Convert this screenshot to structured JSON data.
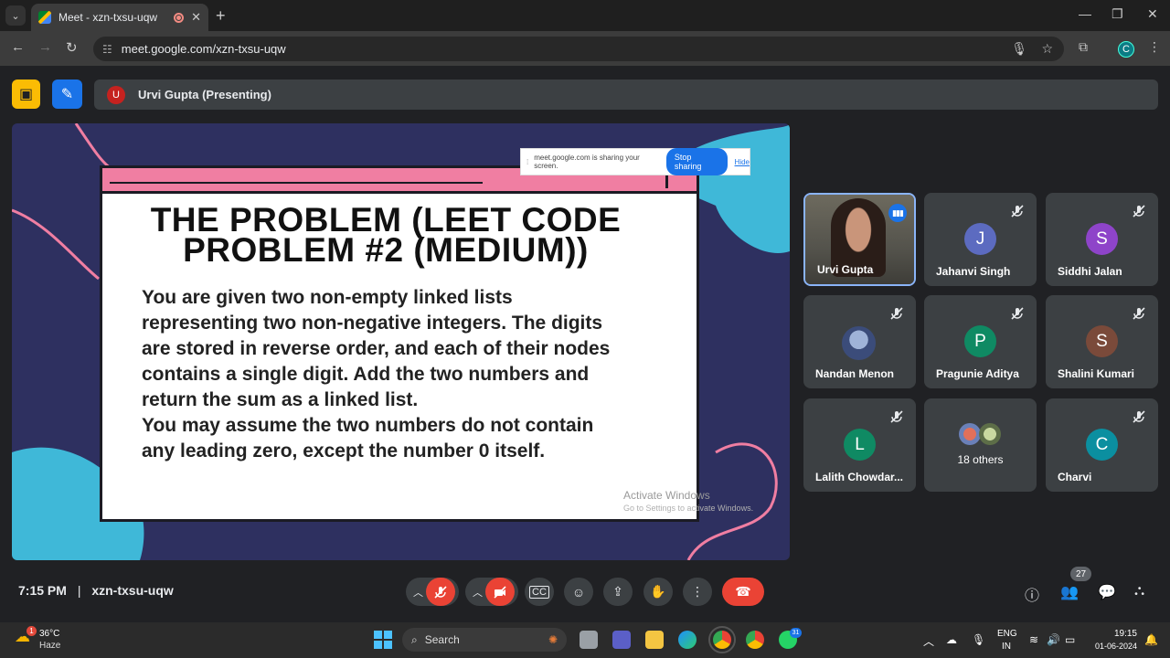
{
  "browser": {
    "tab_title": "Meet - xzn-txsu-uqw",
    "url": "meet.google.com/xzn-txsu-uqw",
    "profile_initial": "C"
  },
  "meet": {
    "presenter_initial": "U",
    "presenter_label": "Urvi Gupta (Presenting)",
    "time": "7:15 PM",
    "separator": "|",
    "meeting_code": "xzn-txsu-uqw",
    "people_count": "27"
  },
  "share_banner": {
    "text": "meet.google.com is sharing your screen.",
    "stop_label": "Stop sharing",
    "hide_label": "Hide"
  },
  "slide": {
    "title_line1": "THE PROBLEM (LEET CODE",
    "title_line2": "PROBLEM #2 (MEDIUM))",
    "body": [
      "You are given two non-empty linked lists",
      "representing two non-negative integers. The digits",
      "are stored in reverse order, and each of their nodes",
      "contains a single digit. Add the two numbers and",
      "return the sum as a linked list.",
      "You may assume the two numbers do not contain",
      "any leading zero, except the number 0 itself."
    ],
    "watermark_line1": "Activate Windows",
    "watermark_line2": "Go to Settings to activate Windows."
  },
  "participants": [
    {
      "name": "Urvi Gupta",
      "initial": "",
      "color": ""
    },
    {
      "name": "Jahanvi Singh",
      "initial": "J",
      "color": "#5c6bc0"
    },
    {
      "name": "Siddhi Jalan",
      "initial": "S",
      "color": "#8e44c9"
    },
    {
      "name": "Nandan Menon",
      "initial": "",
      "color": "#6d7fa8"
    },
    {
      "name": "Pragunie Aditya",
      "initial": "P",
      "color": "#0f8a63"
    },
    {
      "name": "Shalini Kumari",
      "initial": "S",
      "color": "#7a4a3a"
    },
    {
      "name": "Lalith Chowdar...",
      "initial": "L",
      "color": "#0f8a63"
    },
    {
      "name": "18 others",
      "initial": "",
      "color": ""
    },
    {
      "name": "Charvi",
      "initial": "C",
      "color": "#0b8fa0"
    }
  ],
  "taskbar": {
    "temp": "36°C",
    "weather": "Haze",
    "weather_badge": "1",
    "search_label": "Search",
    "lang1": "ENG",
    "lang2": "IN",
    "time": "19:15",
    "date": "01-06-2024",
    "whatsapp_badge": "31"
  },
  "colors": {
    "accent_blue": "#1a73e8",
    "end_call_red": "#ea4335",
    "meet_yellow": "#fbbc04",
    "slide_background": "#2e3060",
    "slide_header_pink": "#f07ea2"
  }
}
